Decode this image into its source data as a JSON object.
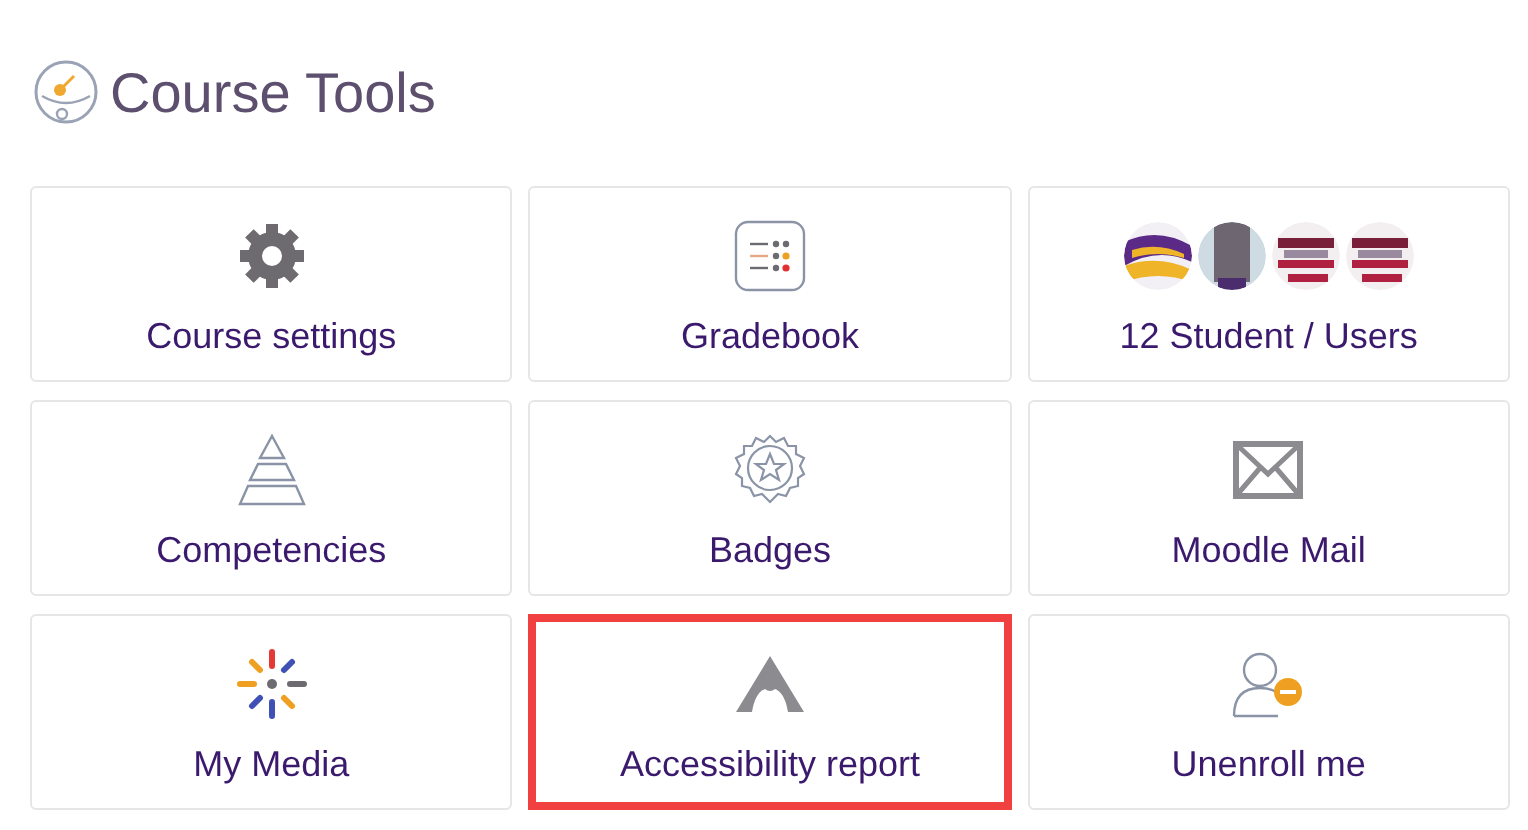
{
  "title": "Course Tools",
  "tiles": [
    {
      "kind": "settings",
      "label": "Course settings",
      "highlighted": false
    },
    {
      "kind": "gradebook",
      "label": "Gradebook",
      "highlighted": false
    },
    {
      "kind": "users",
      "label": "12 Student / Users",
      "highlighted": false
    },
    {
      "kind": "competencies",
      "label": "Competencies",
      "highlighted": false
    },
    {
      "kind": "badges",
      "label": "Badges",
      "highlighted": false
    },
    {
      "kind": "mail",
      "label": "Moodle Mail",
      "highlighted": false
    },
    {
      "kind": "media",
      "label": "My Media",
      "highlighted": false
    },
    {
      "kind": "accessibility",
      "label": "Accessibility report",
      "highlighted": true
    },
    {
      "kind": "unenroll",
      "label": "Unenroll me",
      "highlighted": false
    }
  ]
}
